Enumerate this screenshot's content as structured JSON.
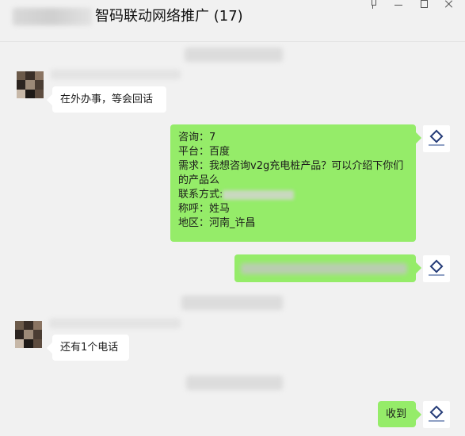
{
  "window": {
    "title": "智码联动网络推广 (17)"
  },
  "messages": [
    {
      "side": "left",
      "text": "在外办事，等会回话"
    },
    {
      "side": "right",
      "lines": [
        "咨询：7",
        "平台：百度",
        "需求：我想咨询v2g充电桩产品？可以介绍下你们的产品么",
        "联系方式:",
        "称呼：姓马",
        "地区：河南_许昌"
      ]
    },
    {
      "side": "left",
      "text": "还有1个电话"
    },
    {
      "side": "right",
      "text": "收到"
    }
  ],
  "avatar_colors": [
    "#6b5a4a",
    "#3a2f28",
    "#8a7462",
    "#2b2420",
    "#9c8a78",
    "#4a3d33",
    "#c7b8a8",
    "#1e1a17",
    "#5d4c3f"
  ]
}
